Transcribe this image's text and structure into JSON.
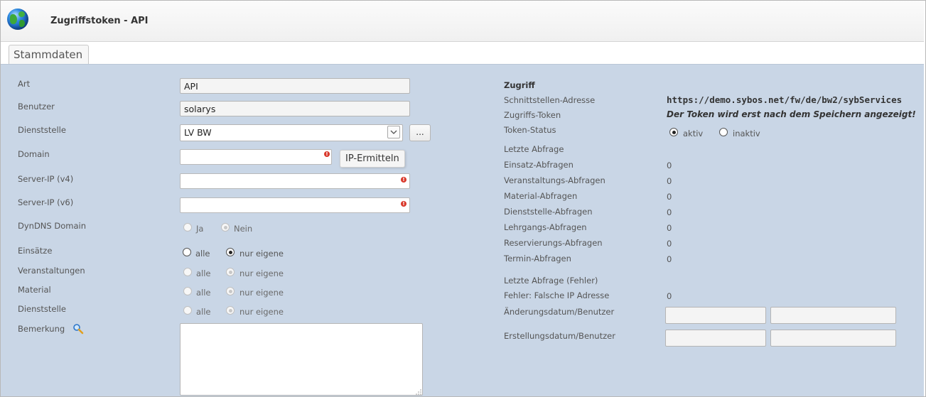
{
  "window": {
    "title": "Zugriffstoken - API",
    "icon": "globe-icon"
  },
  "tabs": [
    {
      "label": "Stammdaten",
      "active": true
    }
  ],
  "form": {
    "art": {
      "label": "Art",
      "value": "API"
    },
    "benutzer": {
      "label": "Benutzer",
      "value": "solarys"
    },
    "dienststelle": {
      "label": "Dienststelle",
      "value": "LV BW",
      "ellipsis": "..."
    },
    "domain": {
      "label": "Domain",
      "value": "",
      "required": true
    },
    "tooltip": "IP-Ermitteln",
    "server_ip_v4": {
      "label": "Server-IP (v4)",
      "value": "",
      "required": true
    },
    "server_ip_v6": {
      "label": "Server-IP (v6)",
      "value": "",
      "required": true
    },
    "dyndns": {
      "label": "DynDNS Domain",
      "options": [
        "Ja",
        "Nein"
      ],
      "selected": "Nein",
      "disabled": true
    },
    "einsaetze": {
      "label": "Einsätze",
      "options": [
        "alle",
        "nur eigene"
      ],
      "selected": "nur eigene",
      "disabled": false
    },
    "veranstaltungen": {
      "label": "Veranstaltungen",
      "options": [
        "alle",
        "nur eigene"
      ],
      "selected": "nur eigene",
      "disabled": true
    },
    "material": {
      "label": "Material",
      "options": [
        "alle",
        "nur eigene"
      ],
      "selected": "nur eigene",
      "disabled": true
    },
    "dienststelle_access": {
      "label": "Dienststelle",
      "options": [
        "alle",
        "nur eigene"
      ],
      "selected": "nur eigene",
      "disabled": true
    },
    "bemerkung": {
      "label": "Bemerkung",
      "value": "",
      "icon": "magnifier-icon"
    }
  },
  "access": {
    "heading": "Zugriff",
    "schnittstelle_label": "Schnittstellen-Adresse",
    "schnittstelle_value": "https://demo.sybos.net/fw/de/bw2/sybServices",
    "token_label": "Zugriffs-Token",
    "token_note": "Der Token wird erst nach dem Speichern angezeigt!",
    "status_label": "Token-Status",
    "status_options": [
      "aktiv",
      "inaktiv"
    ],
    "status_selected": "aktiv",
    "letzte_abfrage_label": "Letzte Abfrage",
    "stats": [
      {
        "label": "Einsatz-Abfragen",
        "value": "0"
      },
      {
        "label": "Veranstaltungs-Abfragen",
        "value": "0"
      },
      {
        "label": "Material-Abfragen",
        "value": "0"
      },
      {
        "label": "Dienststelle-Abfragen",
        "value": "0"
      },
      {
        "label": "Lehrgangs-Abfragen",
        "value": "0"
      },
      {
        "label": "Reservierungs-Abfragen",
        "value": "0"
      },
      {
        "label": "Termin-Abfragen",
        "value": "0"
      }
    ],
    "letzte_fehler_label": "Letzte Abfrage (Fehler)",
    "fehler_ip_label": "Fehler: Falsche IP Adresse",
    "fehler_ip_value": "0",
    "aenderung_label": "Änderungsdatum/Benutzer",
    "aenderung_date": "",
    "aenderung_user": "",
    "erstellung_label": "Erstellungsdatum/Benutzer",
    "erstellung_date": "",
    "erstellung_user": ""
  }
}
